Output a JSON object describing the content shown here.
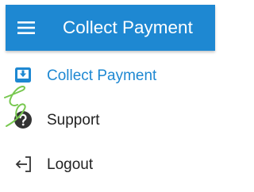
{
  "app_bar": {
    "title": "Collect Payment",
    "menu_icon": "hamburger-menu-icon",
    "background_color": "#1e88d2",
    "title_color": "#ffffff"
  },
  "nav": {
    "items": [
      {
        "label": "Collect Payment",
        "icon": "collect-payment-icon",
        "active": true,
        "color": "#1e88d2"
      },
      {
        "label": "Support",
        "icon": "help-circle-icon",
        "active": false,
        "color": "#222222"
      },
      {
        "label": "Logout",
        "icon": "logout-icon",
        "active": false,
        "color": "#222222"
      }
    ]
  },
  "overlay": {
    "gesture_icon": "touch-gesture-mark",
    "gesture_color": "#78c850"
  }
}
